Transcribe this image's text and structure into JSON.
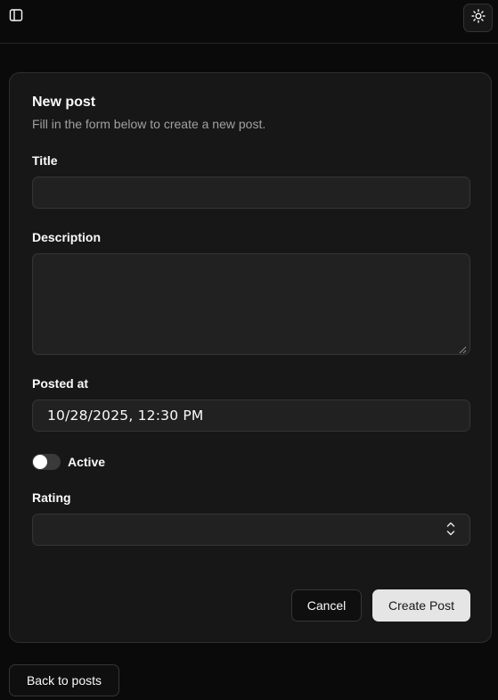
{
  "header": {
    "sidebar_toggle_icon": "panel-left-icon",
    "theme_toggle_icon": "sun-icon"
  },
  "form": {
    "title": "New post",
    "description": "Fill in the form below to create a new post.",
    "fields": {
      "title": {
        "label": "Title",
        "value": ""
      },
      "description": {
        "label": "Description",
        "value": ""
      },
      "posted_at": {
        "label": "Posted at",
        "value": "10/28/2025, 12:30 PM"
      },
      "active": {
        "label": "Active",
        "checked": false
      },
      "rating": {
        "label": "Rating",
        "value": ""
      }
    },
    "actions": {
      "cancel_label": "Cancel",
      "submit_label": "Create Post"
    }
  },
  "footer": {
    "back_label": "Back to posts"
  },
  "colors": {
    "background": "#0a0a0a",
    "card": "#171717",
    "input": "#212121",
    "primary_button": "#e5e5e5",
    "muted_text": "#a1a1a1"
  }
}
